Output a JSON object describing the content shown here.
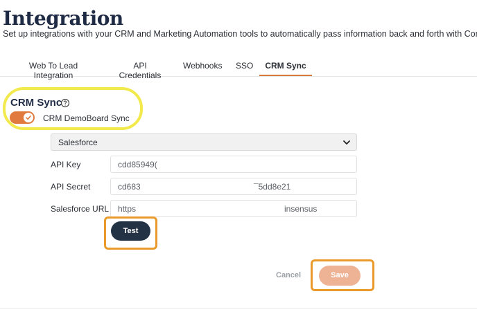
{
  "header": {
    "title": "Integration",
    "subtitle": "Set up integrations with your CRM and Marketing Automation tools to automatically pass information back and forth with Consensus"
  },
  "tabs": [
    {
      "label": "Web To Lead Integration",
      "active": false
    },
    {
      "label": "API Credentials",
      "active": false
    },
    {
      "label": "Webhooks",
      "active": false
    },
    {
      "label": "SSO",
      "active": false
    },
    {
      "label": "CRM Sync",
      "active": true
    }
  ],
  "crm_sync": {
    "title": "CRM Sync",
    "help_icon": "question-circle-icon",
    "toggle": {
      "label": "CRM DemoBoard Sync",
      "on": true
    },
    "provider": {
      "selected": "Salesforce"
    },
    "fields": {
      "api_key": {
        "label": "API Key",
        "value_start": "cdd85949(",
        "value_end": ""
      },
      "api_secret": {
        "label": "API Secret",
        "value_start": "cd683",
        "value_end": "¯5dd8e21"
      },
      "salesforce_url": {
        "label": "Salesforce URL",
        "value_start": "https",
        "value_end": "insensus"
      }
    },
    "test_label": "Test"
  },
  "actions": {
    "cancel_label": "Cancel",
    "save_label": "Save"
  },
  "colors": {
    "accent": "#e07a3f",
    "navy": "#243246",
    "save_disabled": "#eeb395",
    "highlight_yellow": "#f2ea4d",
    "highlight_orange": "#ea9a2a"
  }
}
